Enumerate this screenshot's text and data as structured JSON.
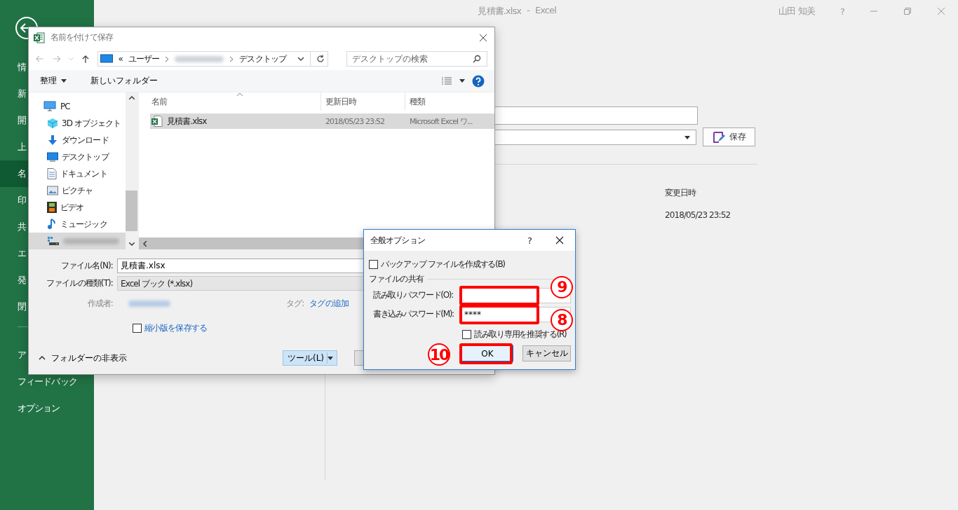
{
  "app": {
    "title": "見積書.xlsx",
    "separator": "-",
    "app_name": "Excel",
    "user": "山田 知美",
    "help": "?"
  },
  "sidebar": {
    "items": [
      {
        "label": "情",
        "selected": false
      },
      {
        "label": "新",
        "selected": false
      },
      {
        "label": "開",
        "selected": false
      },
      {
        "label": "上",
        "selected": false
      },
      {
        "label": "名",
        "selected": true
      },
      {
        "label": "印",
        "selected": false
      },
      {
        "label": "共",
        "selected": false
      },
      {
        "label": "エ",
        "selected": false
      },
      {
        "label": "発",
        "selected": false
      },
      {
        "label": "閉",
        "selected": false
      }
    ],
    "bottom_items": [
      {
        "label": "ア"
      },
      {
        "label": "フィードバック"
      },
      {
        "label": "オプション"
      }
    ]
  },
  "backstage": {
    "save_button": "保存",
    "column_header": "変更日時",
    "modified": "2018/05/23 23:52"
  },
  "save_dialog": {
    "title": "名前を付けて保存",
    "breadcrumb_prefix": "«",
    "breadcrumb": [
      "ユーザー",
      "デスクトップ"
    ],
    "search_placeholder": "デスクトップの検索",
    "organize": "整理",
    "new_folder": "新しいフォルダー",
    "tree": [
      {
        "label": "PC",
        "kind": "pc",
        "selected": false,
        "children": [
          {
            "label": "3D オブジェクト",
            "kind": "cube",
            "selected": false
          },
          {
            "label": "ダウンロード",
            "kind": "download",
            "selected": false
          },
          {
            "label": "デスクトップ",
            "kind": "desktop",
            "selected": false
          },
          {
            "label": "ドキュメント",
            "kind": "document",
            "selected": false
          },
          {
            "label": "ピクチャ",
            "kind": "picture",
            "selected": false
          },
          {
            "label": "ビデオ",
            "kind": "video",
            "selected": false
          },
          {
            "label": "ミュージック",
            "kind": "music",
            "selected": false
          },
          {
            "kind": "drive",
            "selected": true
          }
        ]
      }
    ],
    "columns": [
      "名前",
      "更新日時",
      "種類"
    ],
    "rows": [
      {
        "name": "見積書.xlsx",
        "modified": "2018/05/23 23:52",
        "type": "Microsoft Excel ワ...",
        "selected": true
      }
    ],
    "file_name_label": "ファイル名(N):",
    "file_name": "見積書.xlsx",
    "file_type_label": "ファイルの種類(T):",
    "file_type": "Excel ブック (*.xlsx)",
    "author_label": "作成者:",
    "tags_label": "タグ:",
    "tags_link": "タグの追加",
    "thumbnail": {
      "label": "縮小版を保存する",
      "checked": false
    },
    "hide_folders": "フォルダーの非表示",
    "tools_button": "ツール(L)"
  },
  "options_dialog": {
    "title": "全般オプション",
    "help": "?",
    "backup": {
      "label": "バックアップ ファイルを作成する(B)",
      "checked": false
    },
    "group": "ファイルの共有",
    "read_password": {
      "label": "読み取りパスワード(O):",
      "highlighted": true,
      "callout": "9"
    },
    "write_password": {
      "label": "書き込みパスワード(M):",
      "value": "****",
      "highlighted": true,
      "callout": "8"
    },
    "read_only": {
      "label": "読み取り専用を推奨する(R)",
      "checked": false
    },
    "ok_button": {
      "label": "OK",
      "highlighted": true,
      "callout": "10"
    },
    "cancel_button": "キャンセル"
  }
}
